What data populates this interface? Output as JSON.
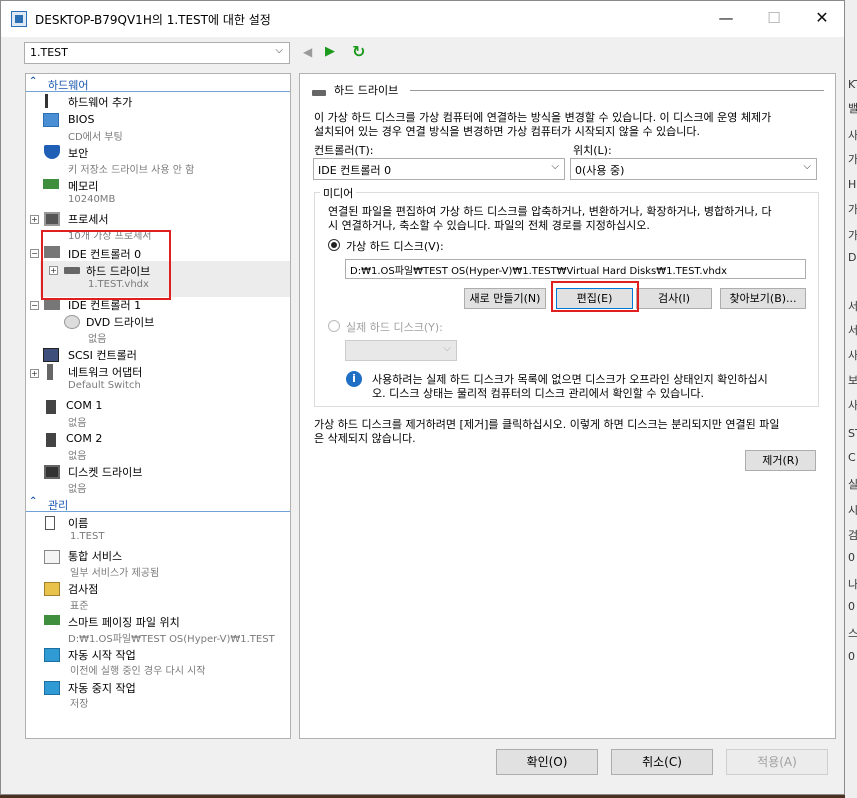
{
  "window": {
    "title": "DESKTOP-B79QV1H의 1.TEST에 대한 설정",
    "minimize": "—",
    "maximize": "☐",
    "close": "✕"
  },
  "toolbar": {
    "vm_selected": "1.TEST",
    "back_glyph": "◀",
    "forward_glyph": "▶",
    "refresh_glyph": "↻"
  },
  "tree": {
    "hardware_section": "하드웨어",
    "management_section": "관리",
    "items": {
      "add_hardware": "하드웨어 추가",
      "bios": "BIOS",
      "bios_sub": "CD에서 부팅",
      "security": "보안",
      "security_sub": "키 저장소 드라이브 사용 안 함",
      "memory": "메모리",
      "memory_sub": "10240MB",
      "processor": "프로세서",
      "processor_sub": "10개 가상 프로세서",
      "ide0": "IDE 컨트롤러 0",
      "hard_drive": "하드 드라이브",
      "hard_drive_sub": "1.TEST.vhdx",
      "ide1": "IDE 컨트롤러 1",
      "dvd": "DVD 드라이브",
      "dvd_sub": "없음",
      "scsi": "SCSI 컨트롤러",
      "network": "네트워크 어댑터",
      "network_sub": "Default Switch",
      "com1": "COM 1",
      "com1_sub": "없음",
      "com2": "COM 2",
      "com2_sub": "없음",
      "diskette": "디스켓 드라이브",
      "diskette_sub": "없음",
      "name": "이름",
      "name_sub": "1.TEST",
      "integration": "통합 서비스",
      "integration_sub": "일부 서비스가 제공됨",
      "checkpoint": "검사점",
      "checkpoint_sub": "표준",
      "paging": "스마트 페이징 파일 위치",
      "paging_sub": "D:₩1.OS파일₩TEST OS(Hyper-V)₩1.TEST",
      "auto_start": "자동 시작 작업",
      "auto_start_sub": "이전에 실행 중인 경우 다시 시작",
      "auto_stop": "자동 중지 작업",
      "auto_stop_sub": "저장"
    }
  },
  "panel": {
    "heading": "하드 드라이브",
    "description": "이 가상 하드 디스크를 가상 컴퓨터에 연결하는 방식을 변경할 수 있습니다. 이 디스크에 운영 체제가 설치되어 있는 경우 연결 방식을 변경하면 가상 컴퓨터가 시작되지 않을 수 있습니다.",
    "desc_line1": "이 가상 하드 디스크를 가상 컴퓨터에 연결하는 방식을 변경할 수 있습니다. 이 디스크에 운영 체제가",
    "desc_line2": "설치되어 있는 경우 연결 방식을 변경하면 가상 컴퓨터가 시작되지 않을 수 있습니다.",
    "controller_label": "컨트롤러(T):",
    "controller_value": "IDE 컨트롤러 0",
    "location_label": "위치(L):",
    "location_value": "0(사용 중)",
    "media_label": "미디어",
    "media_desc_line1": "연결된 파일을 편집하여 가상 하드 디스크를 압축하거나, 변환하거나, 확장하거나, 병합하거나, 다",
    "media_desc_line2": "시 연결하거나, 축소할 수 있습니다. 파일의 전체 경로를 지정하십시오.",
    "vhd_radio": "가상 하드 디스크(V):",
    "vhd_path": "D:₩1.OS파일₩TEST OS(Hyper-V)₩1.TEST₩Virtual Hard Disks₩1.TEST.vhdx",
    "btn_new": "새로 만들기(N)",
    "btn_edit": "편집(E)",
    "btn_inspect": "검사(I)",
    "btn_browse": "찾아보기(B)...",
    "physical_radio": "실제 하드 디스크(Y):",
    "info_line1": "사용하려는 실제 하드 디스크가 목록에 없으면 디스크가 오프라인 상태인지 확인하십시",
    "info_line2": "오. 디스크 상태는 물리적 컴퓨터의 디스크 관리에서 확인할 수 있습니다.",
    "remove_line1": "가상 하드 디스크를 제거하려면 [제거]를 클릭하십시오. 이렇게 하면 디스크는 분리되지만 연결된 파일",
    "remove_line2": "은 삭제되지 않습니다.",
    "btn_remove": "제거(R)"
  },
  "footer": {
    "ok": "확인(O)",
    "cancel": "취소(C)",
    "apply": "적용(A)"
  },
  "background": {
    "strip_chars": [
      "KT",
      "밸",
      "사",
      "가",
      "H",
      "가",
      "가",
      "D",
      "서",
      "서",
      "사",
      "보",
      "사",
      "ST",
      "C",
      "실",
      "시",
      "검",
      "0",
      "나",
      "0",
      "스",
      "0"
    ]
  },
  "colors": {
    "accent_blue": "#1a58b0",
    "highlight_red": "#e02020",
    "refresh_green": "#1c9a1c"
  }
}
